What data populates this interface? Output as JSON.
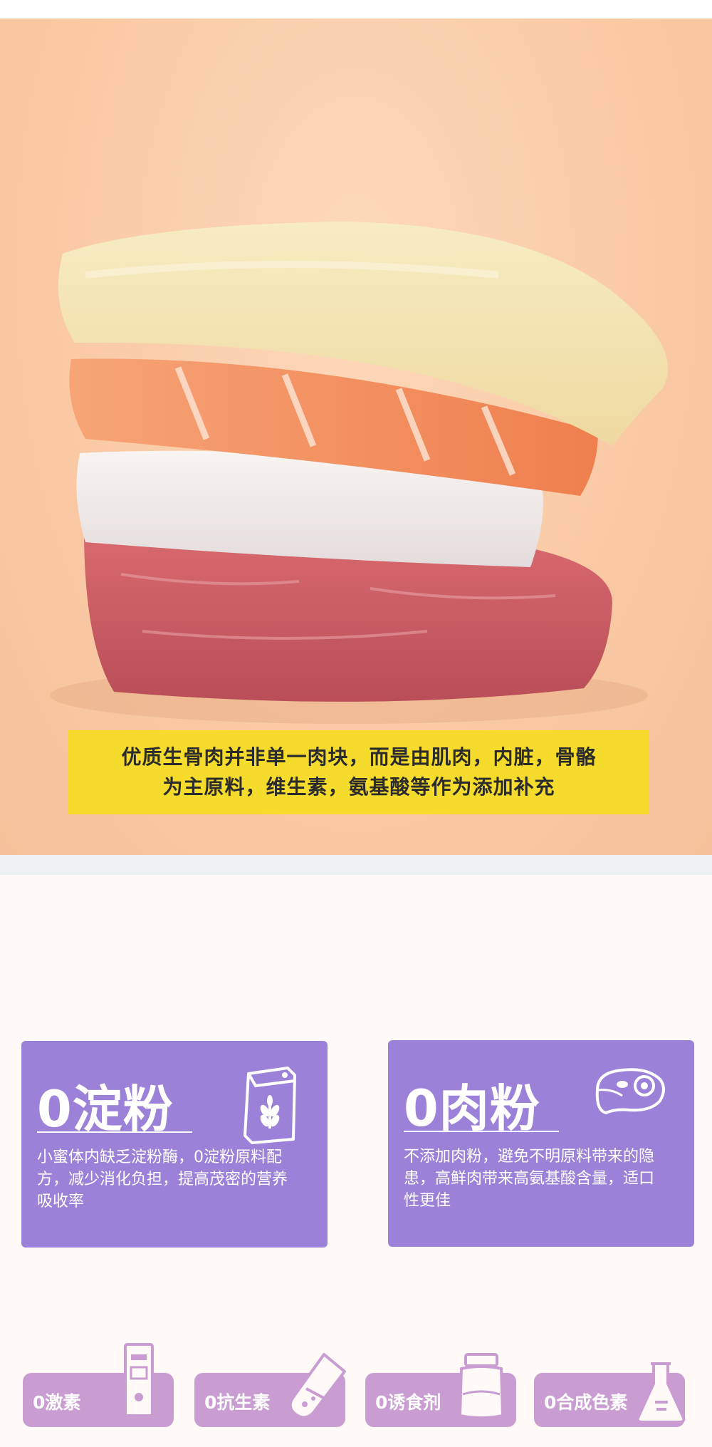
{
  "caption": {
    "line1": "优质生骨肉并非单一肉块，而是由肌肉，内脏，骨骼",
    "line2": "为主原料，维生素，氨基酸等作为添加补充"
  },
  "cards": [
    {
      "title": "0淀粉",
      "description": "小蜜体内缺乏淀粉酶，0淀粉原料配方，减少消化负担，提高茂密的营养吸收率",
      "icon": "grain-bag-icon"
    },
    {
      "title": "0肉粉",
      "description": "不添加肉粉，避免不明原料带来的隐患，高鲜肉带来高氨基酸含量，适口性更佳",
      "icon": "steak-icon"
    }
  ],
  "badges": [
    {
      "label": "0激素",
      "icon": "test-strip-icon"
    },
    {
      "label": "0抗生素",
      "icon": "test-tube-icon"
    },
    {
      "label": "0诱食剂",
      "icon": "jar-icon"
    },
    {
      "label": "0合成色素",
      "icon": "flask-icon"
    }
  ],
  "colors": {
    "background_photo": "#f9c9a3",
    "caption_box": "#f5dc2c",
    "card": "#9b82d8",
    "badge": "#c99dd1"
  }
}
